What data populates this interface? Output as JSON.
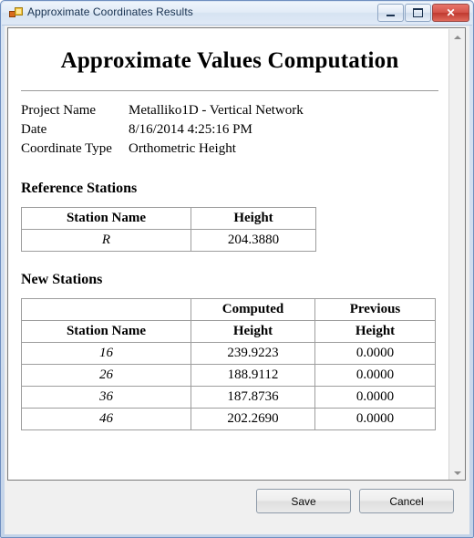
{
  "window": {
    "title": "Approximate Coordinates Results",
    "icon": "app-form-icon",
    "controls": {
      "minimize": "minimize-icon",
      "maximize": "maximize-icon",
      "close": "✕"
    }
  },
  "report": {
    "title": "Approximate Values Computation",
    "meta": [
      {
        "label": "Project Name",
        "value": "Metalliko1D - Vertical Network"
      },
      {
        "label": "Date",
        "value": "8/16/2014 4:25:16 PM"
      },
      {
        "label": "Coordinate Type",
        "value": "Orthometric Height"
      }
    ],
    "reference_section": {
      "heading": "Reference Stations",
      "columns": [
        "Station Name",
        "Height"
      ],
      "rows": [
        {
          "station": "R",
          "height": "204.3880"
        }
      ]
    },
    "new_section": {
      "heading": "New Stations",
      "group_headers": [
        "",
        "Computed",
        "Previous"
      ],
      "columns": [
        "Station Name",
        "Height",
        "Height"
      ],
      "rows": [
        {
          "station": "16",
          "computed": "239.9223",
          "previous": "0.0000"
        },
        {
          "station": "26",
          "computed": "188.9112",
          "previous": "0.0000"
        },
        {
          "station": "36",
          "computed": "187.8736",
          "previous": "0.0000"
        },
        {
          "station": "46",
          "computed": "202.2690",
          "previous": "0.0000"
        }
      ]
    }
  },
  "footer": {
    "save_label": "Save",
    "cancel_label": "Cancel"
  },
  "scrollbar": {
    "up_icon": "scroll-up-arrow-icon",
    "down_icon": "scroll-down-arrow-icon"
  }
}
